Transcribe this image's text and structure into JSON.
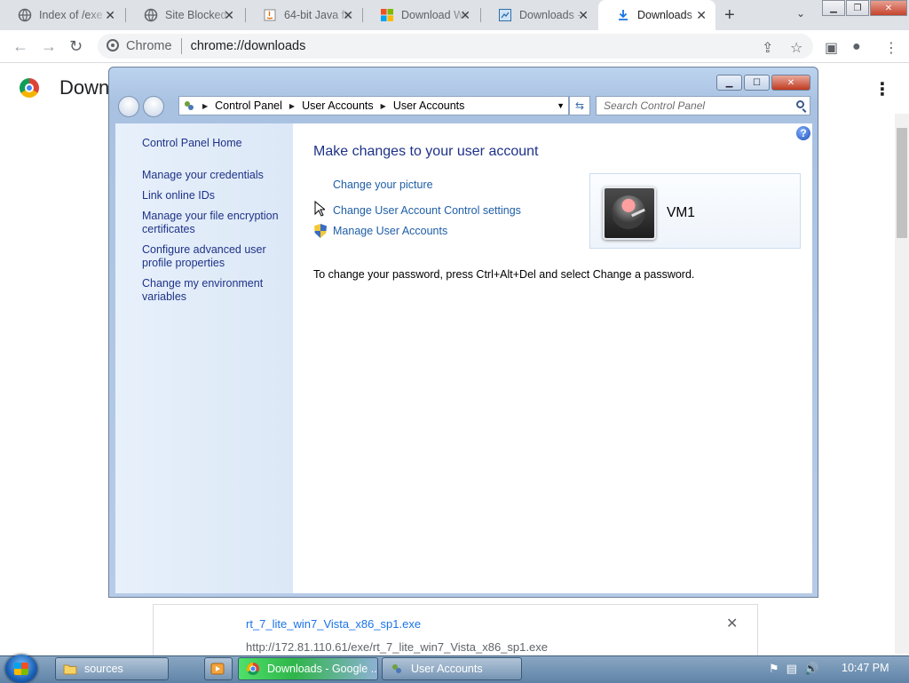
{
  "browser": {
    "tabs": [
      {
        "title": "Index of /exe",
        "icon": "globe-icon"
      },
      {
        "title": "Site Blocked",
        "icon": "globe-icon"
      },
      {
        "title": "64-bit Java for",
        "icon": "java-icon"
      },
      {
        "title": "Download Win",
        "icon": "windows-icon"
      },
      {
        "title": "Downloads - ",
        "icon": "page-icon"
      },
      {
        "title": "Downloads",
        "icon": "download-icon"
      }
    ],
    "site_label": "Chrome",
    "url": "chrome://downloads",
    "page_title": "Downloads"
  },
  "downloads": {
    "file_name": "rt_7_lite_win7_Vista_x86_sp1.exe",
    "file_url": "http://172.81.110.61/exe/rt_7_lite_win7_Vista_x86_sp1.exe"
  },
  "control_panel": {
    "breadcrumb": [
      "Control Panel",
      "User Accounts",
      "User Accounts"
    ],
    "search_placeholder": "Search Control Panel",
    "left_links": [
      "Control Panel Home",
      "Manage your credentials",
      "Link online IDs",
      "Manage your file encryption certificates",
      "Configure advanced user profile properties",
      "Change my environment variables"
    ],
    "title": "Make changes to your user account",
    "actions": [
      "Change your picture",
      "Change User Account Control settings",
      "Manage User Accounts"
    ],
    "user_name": "VM1",
    "password_hint": "To change your password, press Ctrl+Alt+Del and select Change a password."
  },
  "taskbar": {
    "items": [
      "sources",
      "Downloads - Google ...",
      "User Accounts"
    ],
    "time": "10:47 PM"
  }
}
